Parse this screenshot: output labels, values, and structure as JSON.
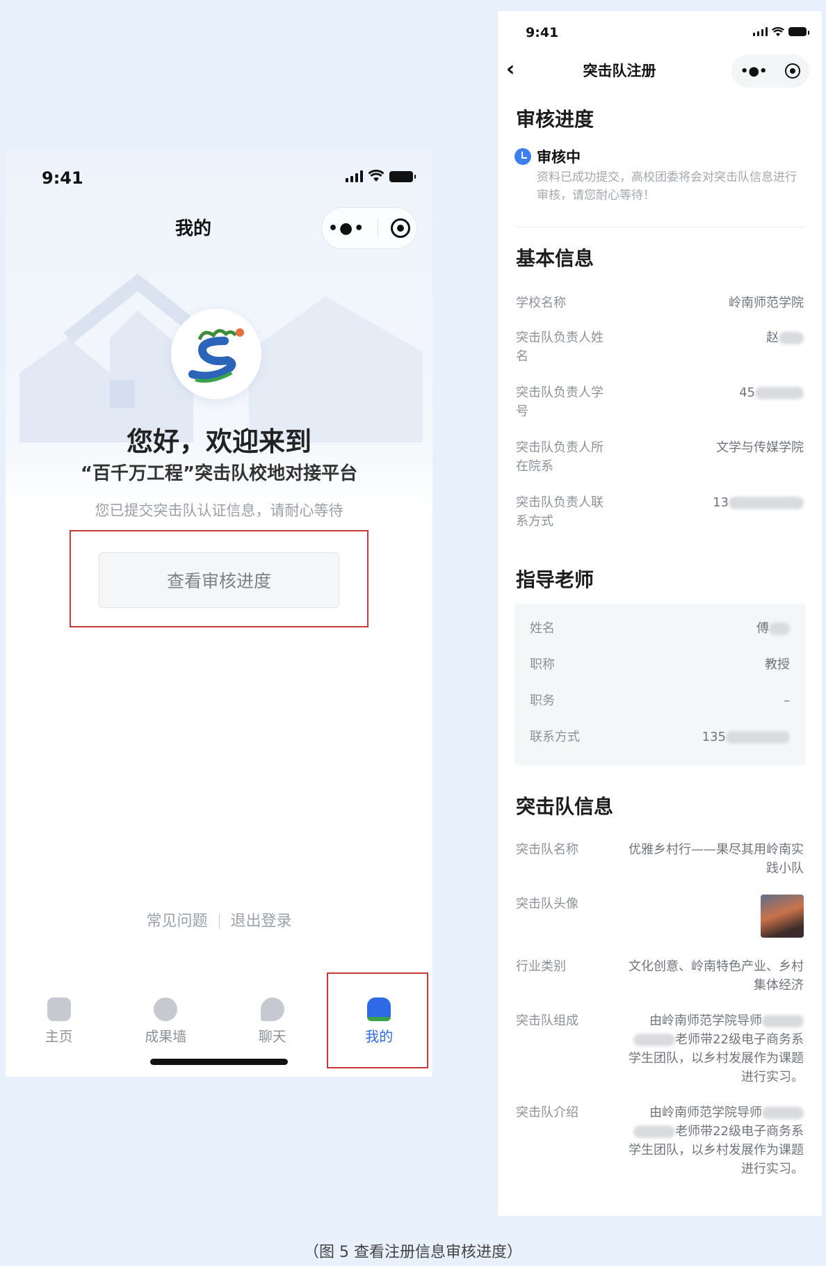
{
  "left_screen": {
    "status_time": "9:41",
    "nav_title": "我的",
    "welcome_line1": "您好，欢迎来到",
    "welcome_line2": "“百千万工程”突击队校地对接平台",
    "hint": "您已提交突击队认证信息，请耐心等待",
    "check_progress_button": "查看审核进度",
    "footer_links": [
      "常见问题",
      "退出登录"
    ],
    "tabs": [
      {
        "label": "主页",
        "icon": "home-icon"
      },
      {
        "label": "成果墙",
        "icon": "achievement-icon"
      },
      {
        "label": "聊天",
        "icon": "chat-icon"
      },
      {
        "label": "我的",
        "icon": "profile-icon",
        "active": true
      }
    ]
  },
  "right_screen": {
    "status_time": "9:41",
    "nav_title": "突击队注册",
    "review": {
      "section_title": "审核进度",
      "status": "审核中",
      "description": "资料已成功提交，高校团委将会对突击队信息进行审核，请您耐心等待！"
    },
    "basic_info": {
      "section_title": "基本信息",
      "rows": [
        {
          "label": "学校名称",
          "value": "岭南师范学院"
        },
        {
          "label": "突击队负责人姓名",
          "value": "赵"
        },
        {
          "label": "突击队负责人学号",
          "value": "45"
        },
        {
          "label": "突击队负责人所在院系",
          "value": "文学与传媒学院"
        },
        {
          "label": "突击队负责人联系方式",
          "value": "13"
        }
      ]
    },
    "teacher": {
      "section_title": "指导老师",
      "rows": [
        {
          "label": "姓名",
          "value": "傅"
        },
        {
          "label": "职称",
          "value": "教授"
        },
        {
          "label": "职务",
          "value": "–"
        },
        {
          "label": "联系方式",
          "value": "135"
        }
      ]
    },
    "team": {
      "section_title": "突击队信息",
      "name_label": "突击队名称",
      "name_value": "优雅乡村行——果尽其用岭南实践小队",
      "avatar_label": "突击队头像",
      "industry_label": "行业类别",
      "industry_value": "文化创意、岭南特色产业、乡村集体经济",
      "composition_label": "突击队组成",
      "composition_prefix": "由岭南师范学院导师",
      "composition_suffix": "老师带22级电子商务系学生团队，以乡村发展作为课题进行实习。",
      "intro_label": "突击队介绍",
      "intro_prefix": "由岭南师范学院导师",
      "intro_suffix": "老师带22级电子商务系学生团队，以乡村发展作为课题进行实习。"
    }
  },
  "caption": "（图 5 查看注册信息审核进度）",
  "colors": {
    "accent": "#2f6ae6",
    "highlight_box": "#c43a3a",
    "status_blue": "#3d7ef0"
  }
}
